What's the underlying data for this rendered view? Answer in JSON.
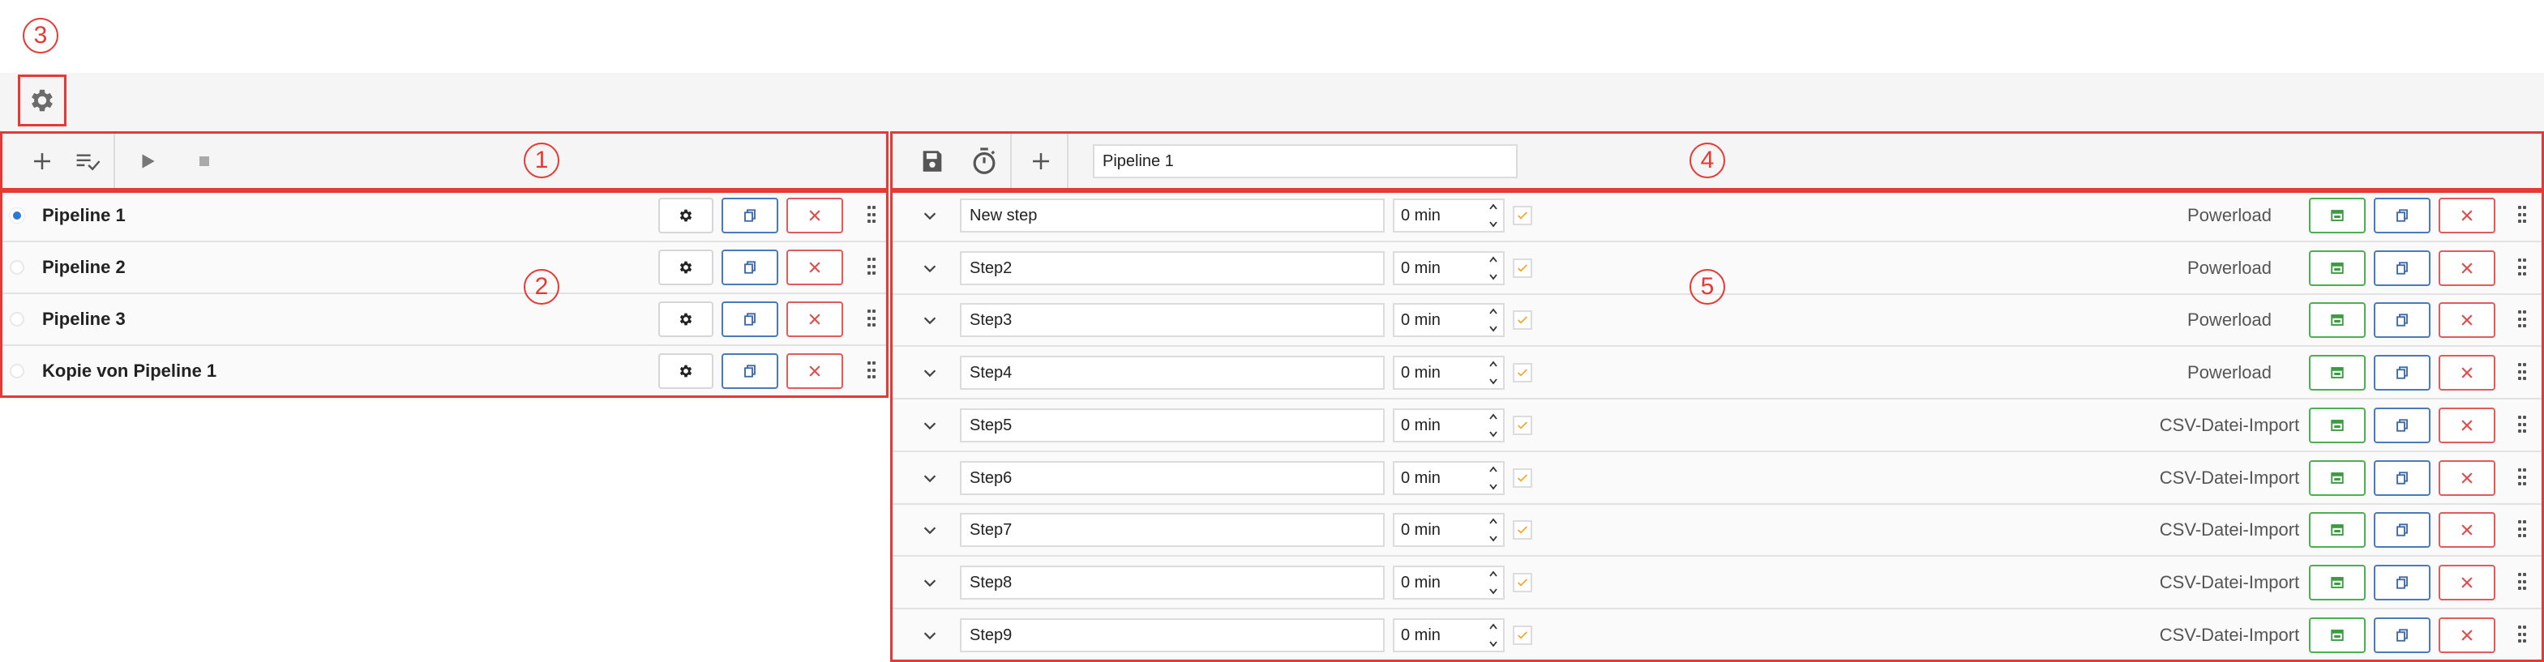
{
  "callouts": {
    "c1": "1",
    "c2": "2",
    "c3": "3",
    "c4": "4",
    "c5": "5"
  },
  "settings": {
    "icon": "gear-icon"
  },
  "left_toolbar": {
    "buttons": [
      {
        "icon": "plus-icon",
        "name": "add-pipeline"
      },
      {
        "icon": "playlist-check-icon",
        "name": "select-pipelines"
      },
      {
        "icon": "play-icon",
        "name": "run-pipeline"
      },
      {
        "icon": "stop-icon",
        "name": "stop-pipeline"
      }
    ]
  },
  "pipelines": [
    {
      "name": "Pipeline 1",
      "selected": true
    },
    {
      "name": "Pipeline 2",
      "selected": false
    },
    {
      "name": "Pipeline 3",
      "selected": false
    },
    {
      "name": "Kopie von Pipeline 1",
      "selected": false
    }
  ],
  "right_toolbar": {
    "buttons": [
      {
        "icon": "save-icon",
        "name": "save"
      },
      {
        "icon": "timer-icon",
        "name": "timer"
      },
      {
        "icon": "plus-icon",
        "name": "add-step"
      }
    ],
    "pipeline_name_value": "Pipeline 1"
  },
  "steps": [
    {
      "name": "New step",
      "duration": "0 min",
      "type": "Powerload"
    },
    {
      "name": "Step2",
      "duration": "0 min",
      "type": "Powerload"
    },
    {
      "name": "Step3",
      "duration": "0 min",
      "type": "Powerload"
    },
    {
      "name": "Step4",
      "duration": "0 min",
      "type": "Powerload"
    },
    {
      "name": "Step5",
      "duration": "0 min",
      "type": "CSV-Datei-Import"
    },
    {
      "name": "Step6",
      "duration": "0 min",
      "type": "CSV-Datei-Import"
    },
    {
      "name": "Step7",
      "duration": "0 min",
      "type": "CSV-Datei-Import"
    },
    {
      "name": "Step8",
      "duration": "0 min",
      "type": "CSV-Datei-Import"
    },
    {
      "name": "Step9",
      "duration": "0 min",
      "type": "CSV-Datei-Import"
    }
  ],
  "colors": {
    "accent_red": "#e53935",
    "check_orange": "#f5a623",
    "radio_blue": "#2b7bd6",
    "btn_blue": "#4a7ab8",
    "btn_green": "#4caf50",
    "btn_red": "#e05b5b"
  }
}
